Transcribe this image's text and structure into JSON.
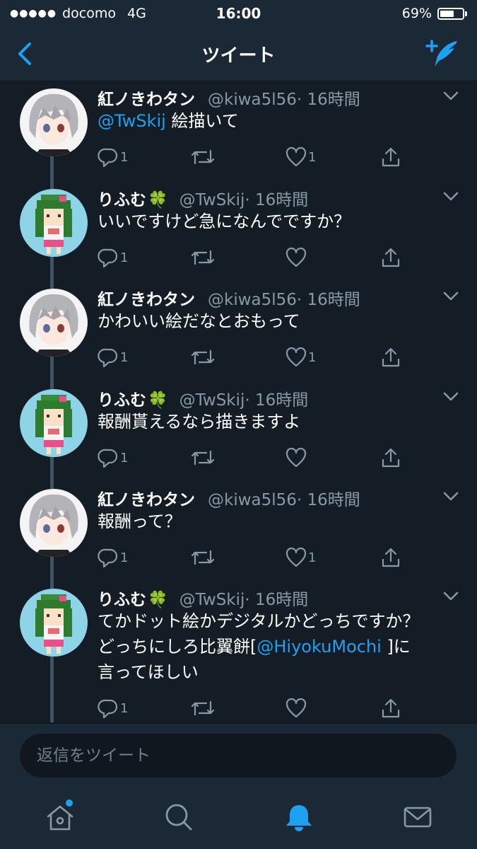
{
  "status_bar": {
    "signal_dots": "●●●●●",
    "carrier": "docomo",
    "network": "4G",
    "time": "16:00",
    "battery_percent": "69%",
    "battery_level": 0.69
  },
  "nav": {
    "title": "ツイート",
    "back_icon": "chevron-left-icon",
    "compose_icon": "compose-tweet-icon"
  },
  "colors": {
    "background": "#141d26",
    "bar": "#1b2836",
    "accent": "#1da1f2",
    "muted": "#8899a6"
  },
  "tweets": [
    {
      "name": "紅ノきわタン",
      "emoji": "",
      "handle": "@kiwa5l56",
      "time": "· 16時間",
      "mention": "@TwSkij",
      "text": " 絵描いて",
      "reply_count": "1",
      "retweet_count": "",
      "like_count": "1",
      "avatar": "gray-hair-anime-avatar"
    },
    {
      "name": "りふむ",
      "emoji": "🍀",
      "handle": "@TwSkij",
      "time": "· 16時間",
      "mention": "",
      "text": "いいですけど急になんでですか？",
      "reply_count": "1",
      "retweet_count": "",
      "like_count": "",
      "avatar": "pixel-art-green-hair-avatar"
    },
    {
      "name": "紅ノきわタン",
      "emoji": "",
      "handle": "@kiwa5l56",
      "time": "· 16時間",
      "mention": "",
      "text": "かわいい絵だなとおもって",
      "reply_count": "1",
      "retweet_count": "",
      "like_count": "1",
      "avatar": "gray-hair-anime-avatar"
    },
    {
      "name": "りふむ",
      "emoji": "🍀",
      "handle": "@TwSkij",
      "time": "· 16時間",
      "mention": "",
      "text": "報酬貰えるなら描きますよ",
      "reply_count": "1",
      "retweet_count": "",
      "like_count": "",
      "avatar": "pixel-art-green-hair-avatar"
    },
    {
      "name": "紅ノきわタン",
      "emoji": "",
      "handle": "@kiwa5l56",
      "time": "· 16時間",
      "mention": "",
      "text": "報酬って？",
      "reply_count": "1",
      "retweet_count": "",
      "like_count": "1",
      "avatar": "gray-hair-anime-avatar"
    },
    {
      "name": "りふむ",
      "emoji": "🍀",
      "handle": "@TwSkij",
      "time": "· 16時間",
      "mention": "",
      "text_line1": "てかドット絵かデジタルかどっちですか？",
      "text_line2_pre": "どっちにしろ比翼餅[",
      "text_line2_mention": "@HiyokuMochi",
      "text_line2_post": " ]に",
      "text_line3": "言ってほしい",
      "reply_count": "1",
      "retweet_count": "",
      "like_count": "",
      "avatar": "pixel-art-green-hair-avatar"
    }
  ],
  "reply_bar": {
    "placeholder": "返信をツイート"
  },
  "tabs": [
    {
      "name": "home",
      "icon": "home-icon",
      "has_notification_dot": true
    },
    {
      "name": "search",
      "icon": "search-icon"
    },
    {
      "name": "notifications",
      "icon": "bell-icon",
      "active": true
    },
    {
      "name": "messages",
      "icon": "envelope-icon"
    }
  ]
}
